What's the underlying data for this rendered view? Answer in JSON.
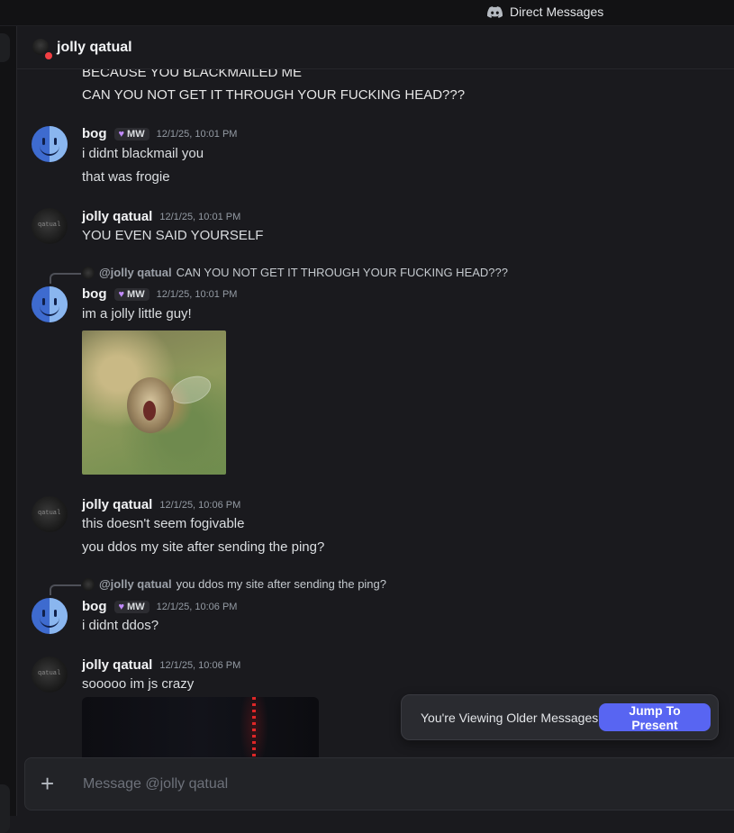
{
  "titlebar": {
    "title": "Direct Messages",
    "icon": "discord-icon"
  },
  "header": {
    "name": "jolly qatual",
    "status": "do-not-disturb"
  },
  "messages": {
    "top_lines": [
      "BECAUSE YOU BLACKMAILED ME",
      "CAN YOU NOT GET IT THROUGH YOUR FUCKING HEAD???"
    ],
    "m1": {
      "user": "bog",
      "badge": "MW",
      "time": "12/1/25, 10:01 PM",
      "lines": [
        "i didnt blackmail you",
        "that was frogie"
      ]
    },
    "m2": {
      "user": "jolly qatual",
      "time": "12/1/25, 10:01 PM",
      "lines": [
        "YOU EVEN SAID YOURSELF"
      ]
    },
    "m3": {
      "reply_mention": "@jolly qatual",
      "reply_text": "CAN YOU NOT GET IT THROUGH YOUR FUCKING HEAD???",
      "user": "bog",
      "badge": "MW",
      "time": "12/1/25, 10:01 PM",
      "lines": [
        "im a jolly little guy!"
      ]
    },
    "m4": {
      "user": "jolly qatual",
      "time": "12/1/25, 10:06 PM",
      "lines": [
        "this doesn't seem fogivable",
        "you ddos my site after sending the ping?"
      ]
    },
    "m5": {
      "reply_mention": "@jolly qatual",
      "reply_text": "you ddos my site after sending the ping?",
      "user": "bog",
      "badge": "MW",
      "time": "12/1/25, 10:06 PM",
      "lines": [
        "i didnt ddos?"
      ]
    },
    "m6": {
      "user": "jolly qatual",
      "time": "12/1/25, 10:06 PM",
      "lines": [
        "sooooo im js crazy"
      ]
    }
  },
  "older_bar": {
    "text": "You're Viewing Older Messages",
    "jump_label": "Jump To Present"
  },
  "composer": {
    "placeholder": "Message @jolly qatual"
  },
  "colors": {
    "accent": "#5865f2",
    "badge_heart": "#c28bff",
    "dnd": "#f23f43"
  }
}
